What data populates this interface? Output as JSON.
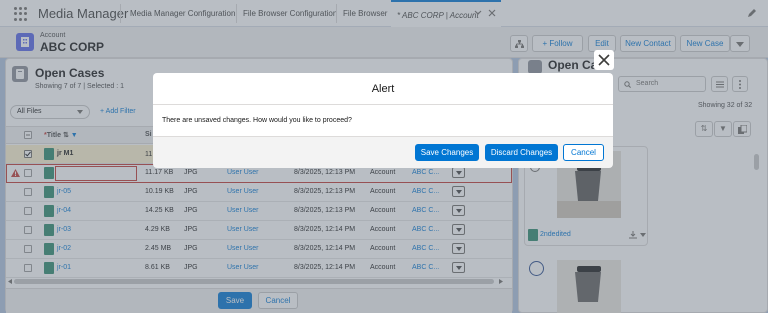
{
  "app": {
    "name": "Media Manager"
  },
  "tabs": [
    {
      "label": "Media Manager Configuration"
    },
    {
      "label": "File Browser Configuration"
    },
    {
      "label": "File Browser"
    },
    {
      "label": "* ABC CORP | Account"
    }
  ],
  "record": {
    "type": "Account",
    "name": "ABC CORP"
  },
  "header_actions": {
    "follow": "Follow",
    "edit": "Edit",
    "new_contact": "New Contact",
    "new_case": "New Case"
  },
  "cases": {
    "title": "Open Cases",
    "subtitle": "Showing 7 of 7 | Selected : 1",
    "filter": "All Files",
    "add_filter": "Add Filter",
    "columns": {
      "title": "Title",
      "size": "Si"
    },
    "rows": [
      {
        "title": "jr M1",
        "size": "11",
        "type": "",
        "owner": "",
        "date": "",
        "object": "",
        "related": ""
      },
      {
        "title": "",
        "size": "11.17 KB",
        "type": "JPG",
        "owner": "User User",
        "date": "8/3/2025, 12:13 PM",
        "object": "Account",
        "related": "ABC C..."
      },
      {
        "title": "jr-05",
        "size": "10.19 KB",
        "type": "JPG",
        "owner": "User User",
        "date": "8/3/2025, 12:13 PM",
        "object": "Account",
        "related": "ABC C..."
      },
      {
        "title": "jr-04",
        "size": "14.25 KB",
        "type": "JPG",
        "owner": "User User",
        "date": "8/3/2025, 12:13 PM",
        "object": "Account",
        "related": "ABC C..."
      },
      {
        "title": "jr-03",
        "size": "4.29 KB",
        "type": "JPG",
        "owner": "User User",
        "date": "8/3/2025, 12:14 PM",
        "object": "Account",
        "related": "ABC C..."
      },
      {
        "title": "jr-02",
        "size": "2.45 MB",
        "type": "JPG",
        "owner": "User User",
        "date": "8/3/2025, 12:14 PM",
        "object": "Account",
        "related": "ABC C..."
      },
      {
        "title": "jr-01",
        "size": "8.61 KB",
        "type": "JPG",
        "owner": "User User",
        "date": "8/3/2025, 12:14 PM",
        "object": "Account",
        "related": "ABC C..."
      }
    ],
    "save": "Save",
    "cancel": "Cancel"
  },
  "right_panel": {
    "title": "Open Ca",
    "search_placeholder": "Search",
    "showing": "Showing 32 of 32",
    "file_name": "2ndedited"
  },
  "modal": {
    "title": "Alert",
    "message": "There are unsaved changes. How would you like to proceed?",
    "save_changes": "Save Changes",
    "discard_changes": "Discard Changes",
    "cancel": "Cancel"
  },
  "colors": {
    "brand": "#0176d3",
    "error": "#c23934",
    "file_icon": "#2e8b6e",
    "account_icon": "#5867e8"
  }
}
